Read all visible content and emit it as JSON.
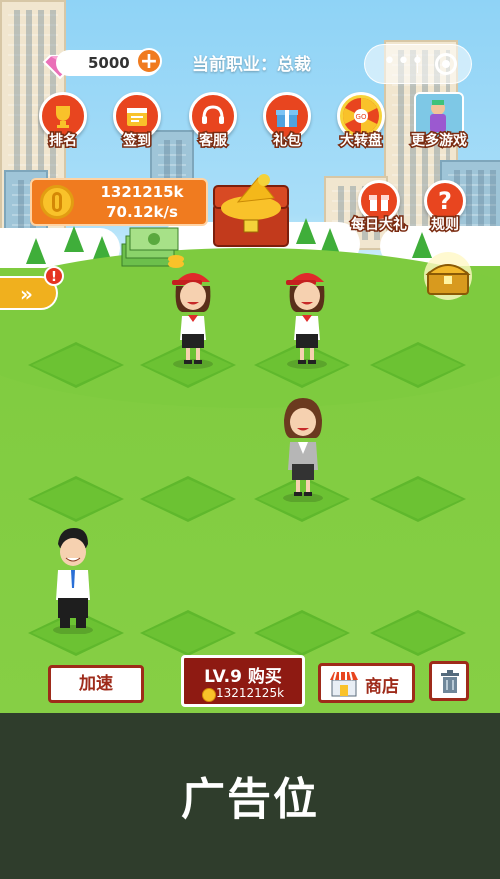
{
  "top_bar": {
    "gems": "5000",
    "plus_label": "+",
    "career": "当前职业：总裁"
  },
  "menu_buttons": {
    "rank": "排名",
    "checkin": "签到",
    "service": "客服",
    "gift": "礼包",
    "wheel": "大转盘",
    "more_games": "更多游戏",
    "daily_gift": "每日大礼",
    "rules": "规则",
    "wheel_badge": "GO"
  },
  "coins": {
    "total": "1321215k",
    "rate": "70.12k/s"
  },
  "side_tab": {
    "chevron": "»",
    "alert": "!"
  },
  "bottom": {
    "speed_label": "加速",
    "buy_level": "LV.9 购买",
    "buy_cost": "13212125k",
    "shop_label": "商店"
  },
  "ad": {
    "label": "广告位"
  },
  "colors": {
    "accent_orange": "#f07b1f",
    "button_red": "#e8451f",
    "dark_red": "#8e1a12",
    "grass": "#86cf45",
    "ad_bg": "#2f3d2c"
  }
}
